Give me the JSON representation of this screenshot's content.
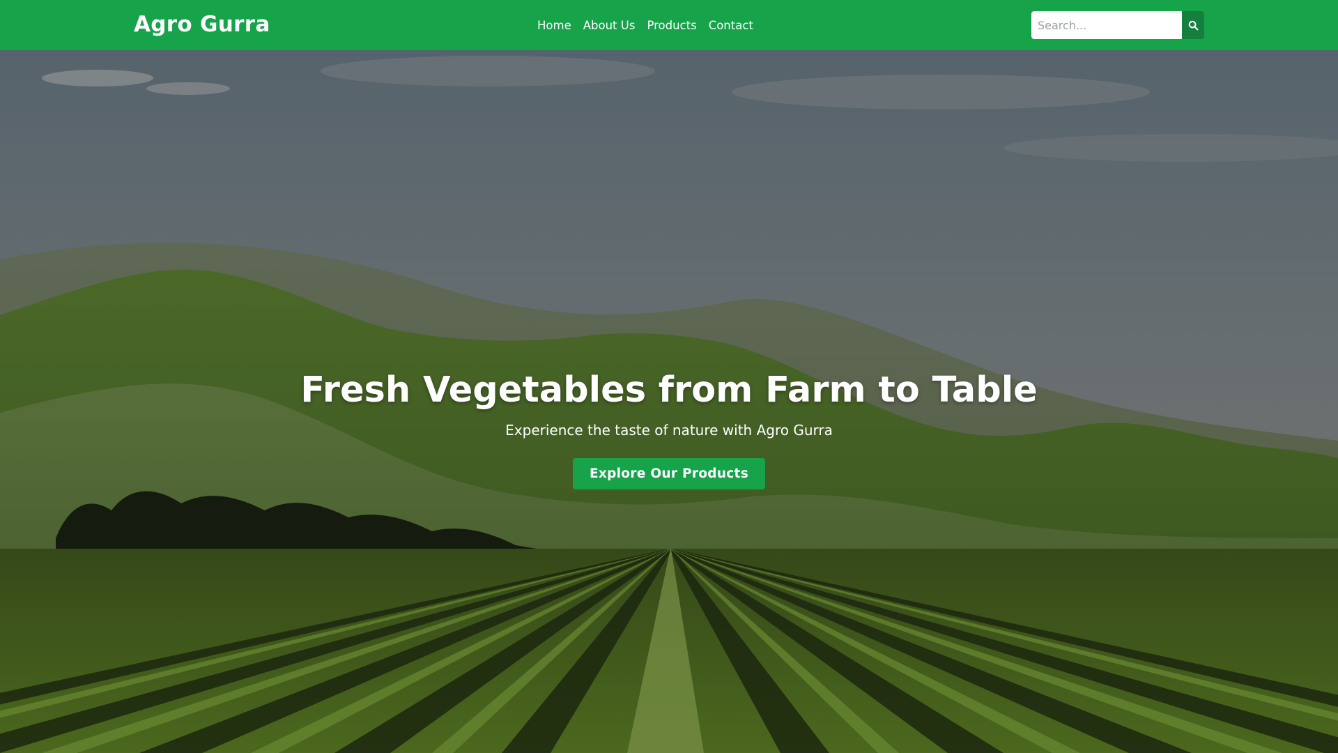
{
  "navbar": {
    "brand": "Agro Gurra",
    "links": [
      {
        "label": "Home"
      },
      {
        "label": "About Us"
      },
      {
        "label": "Products"
      },
      {
        "label": "Contact"
      }
    ],
    "search": {
      "placeholder": "Search...",
      "value": "",
      "button_icon": "search-icon"
    },
    "background_color": "#16a34a"
  },
  "hero": {
    "title": "Fresh Vegetables from Farm to Table",
    "subtitle": "Experience the taste of nature with Agro Gurra",
    "cta_label": "Explore Our Products",
    "cta_color": "#16a34a"
  }
}
